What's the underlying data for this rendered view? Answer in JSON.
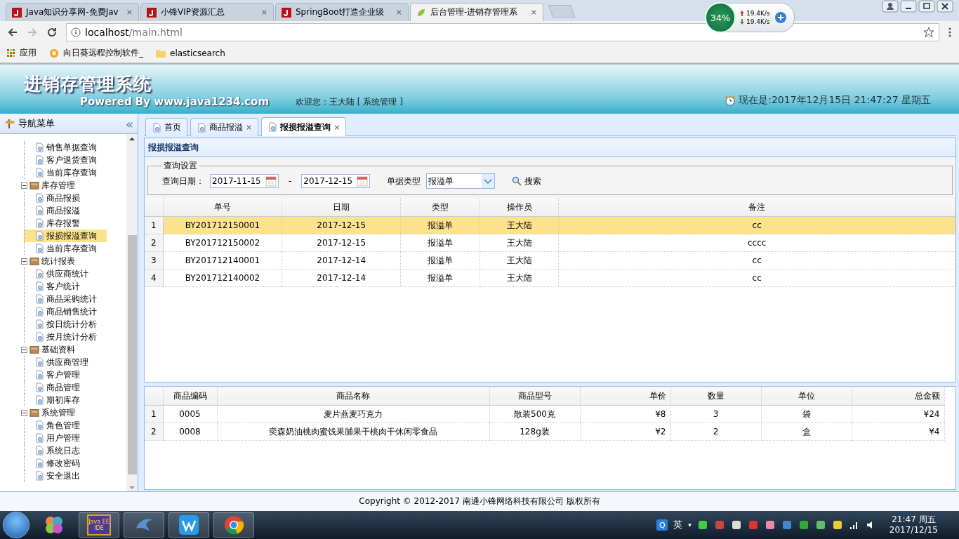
{
  "browser": {
    "tabs": [
      {
        "title": "Java知识分享网-免费Jav",
        "close": "×",
        "selected": false
      },
      {
        "title": "小锋VIP资源汇总",
        "close": "×",
        "selected": false
      },
      {
        "title": "SpringBoot打造企业级",
        "close": "×",
        "selected": false
      },
      {
        "title": "后台管理-进销存管理系",
        "close": "×",
        "selected": true
      }
    ],
    "url_host": "localhost",
    "url_path": "/main.html",
    "bookmarks": [
      "应用",
      "向日葵远程控制软件_",
      "elasticsearch"
    ]
  },
  "net_monitor": {
    "percent": "34%",
    "upload": "19.4K/s",
    "download": "19.4K/s"
  },
  "header": {
    "title": "进销存管理系统",
    "powered_by": "Powered By www.java1234.com",
    "welcome": "欢迎您：王大陆 [ 系统管理 ]",
    "clock": "现在是:2017年12月15日 21:47:27 星期五"
  },
  "nav": {
    "title": "导航菜单",
    "collapse": "«",
    "tree": [
      {
        "children": [
          {
            "label": "销售单据查询",
            "selected": false
          },
          {
            "label": "客户退货查询",
            "selected": false
          },
          {
            "label": "当前库存查询",
            "selected": false
          }
        ]
      },
      {
        "label": "库存管理",
        "expanded": true,
        "children": [
          {
            "label": "商品报损",
            "selected": false
          },
          {
            "label": "商品报溢",
            "selected": false
          },
          {
            "label": "库存报警",
            "selected": false
          },
          {
            "label": "报损报溢查询",
            "selected": true
          },
          {
            "label": "当前库存查询",
            "selected": false
          }
        ]
      },
      {
        "label": "统计报表",
        "expanded": true,
        "children": [
          {
            "label": "供应商统计",
            "selected": false
          },
          {
            "label": "客户统计",
            "selected": false
          },
          {
            "label": "商品采购统计",
            "selected": false
          },
          {
            "label": "商品销售统计",
            "selected": false
          },
          {
            "label": "按日统计分析",
            "selected": false
          },
          {
            "label": "按月统计分析",
            "selected": false
          }
        ]
      },
      {
        "label": "基础资料",
        "expanded": true,
        "children": [
          {
            "label": "供应商管理",
            "selected": false
          },
          {
            "label": "客户管理",
            "selected": false
          },
          {
            "label": "商品管理",
            "selected": false
          },
          {
            "label": "期初库存",
            "selected": false
          }
        ]
      },
      {
        "label": "系统管理",
        "expanded": true,
        "children": [
          {
            "label": "角色管理",
            "selected": false
          },
          {
            "label": "用户管理",
            "selected": false
          },
          {
            "label": "系统日志",
            "selected": false
          },
          {
            "label": "修改密码",
            "selected": false
          },
          {
            "label": "安全退出",
            "selected": false
          }
        ]
      }
    ]
  },
  "content_tabs": [
    {
      "label": "首页",
      "selected": false
    },
    {
      "label": "商品报溢",
      "close": "×",
      "selected": false
    },
    {
      "label": "报损报溢查询",
      "close": "×",
      "selected": true
    }
  ],
  "panel": {
    "title": "报损报溢查询",
    "query": {
      "legend": "查询设置",
      "date_label": "查询日期：",
      "date_from": "2017-11-15",
      "range_separator": "-",
      "date_to": "2017-12-15",
      "type_label": "单据类型",
      "type_value": "报溢单",
      "search": "搜索"
    }
  },
  "orders": {
    "columns": [
      "单号",
      "日期",
      "类型",
      "操作员",
      "备注"
    ],
    "rows": [
      {
        "number": "1",
        "cells": [
          "BY201712150001",
          "2017-12-15",
          "报溢单",
          "王大陆",
          "cc"
        ],
        "selected": true
      },
      {
        "number": "2",
        "cells": [
          "BY201712150002",
          "2017-12-15",
          "报溢单",
          "王大陆",
          "cccc"
        ],
        "selected": false
      },
      {
        "number": "3",
        "cells": [
          "BY201712140001",
          "2017-12-14",
          "报溢单",
          "王大陆",
          "cc"
        ],
        "selected": false
      },
      {
        "number": "4",
        "cells": [
          "BY201712140002",
          "2017-12-14",
          "报溢单",
          "王大陆",
          "cc"
        ],
        "selected": false
      }
    ]
  },
  "items": {
    "columns": [
      "商品编码",
      "商品名称",
      "商品型号",
      "单价",
      "数量",
      "单位",
      "总金额"
    ],
    "rows": [
      {
        "number": "1",
        "cells": [
          "0005",
          "麦片燕麦巧克力",
          "散装500克",
          "¥8",
          "3",
          "袋",
          "¥24"
        ],
        "selected": false
      },
      {
        "number": "2",
        "cells": [
          "0008",
          "奕森奶油桃肉蜜饯果脯果干桃肉干休闲零食品",
          "128g装",
          "¥2",
          "2",
          "盒",
          "¥4"
        ],
        "selected": false
      }
    ]
  },
  "footer": "Copyright © 2012-2017 南通小锋网络科技有限公司 版权所有",
  "taskbar": {
    "ide_label": "Java EE IDE",
    "ime_badge": "Q",
    "ime_lang": "英",
    "ime_caret": "▾",
    "time": "21:47 周五",
    "date": "2017/12/15"
  }
}
